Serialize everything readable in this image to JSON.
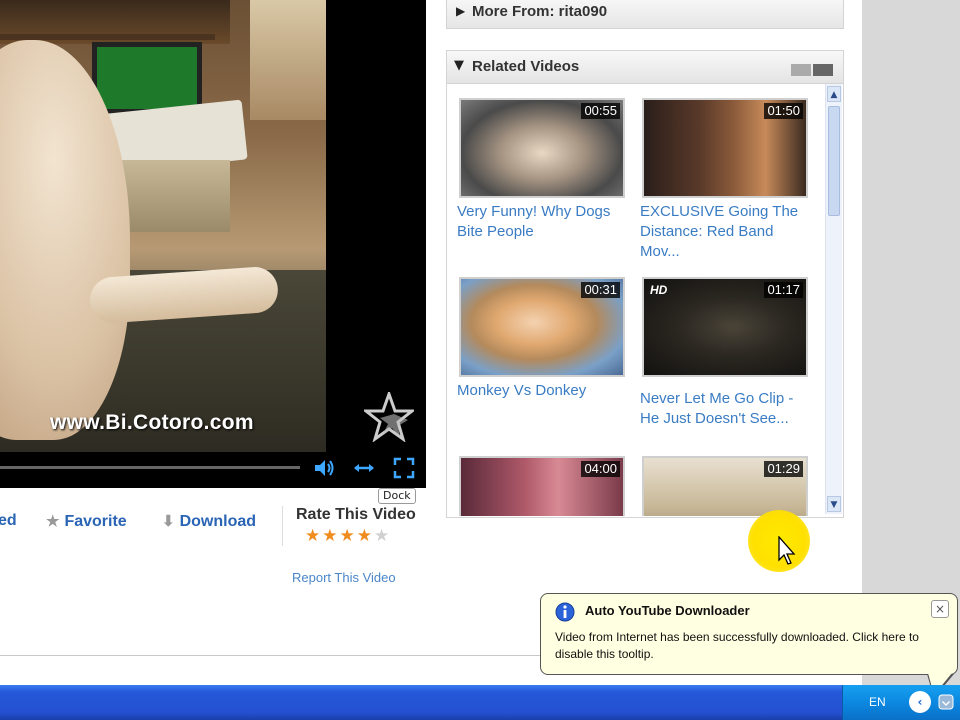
{
  "player": {
    "watermark": "www.Bi.Cotoro.com",
    "progress_fraction": 0.0,
    "dock_tooltip": "Dock"
  },
  "actions": {
    "items": [
      {
        "label": "ed",
        "icon": "embed-icon"
      },
      {
        "label": "Favorite",
        "icon": "star-icon"
      },
      {
        "label": "Download",
        "icon": "download-arrow-icon"
      }
    ],
    "rate_label": "Rate This Video",
    "rating": {
      "value": 4,
      "max": 5
    },
    "report": "Report This Video"
  },
  "more_from": {
    "label": "More From: rita090"
  },
  "related": {
    "label": "Related Videos",
    "videos": [
      {
        "title": "Very Funny! Why Dogs Bite People",
        "duration": "00:55",
        "hd": ""
      },
      {
        "title": "EXCLUSIVE Going The Distance: Red Band Mov...",
        "duration": "01:50",
        "hd": ""
      },
      {
        "title": "Monkey Vs Donkey",
        "duration": "00:31",
        "hd": ""
      },
      {
        "title": "Never Let Me Go Clip - He Just Doesn't See...",
        "duration": "01:17",
        "hd": "HD"
      },
      {
        "title": "",
        "duration": "04:00",
        "hd": ""
      },
      {
        "title": "",
        "duration": "01:29",
        "hd": ""
      }
    ]
  },
  "notification": {
    "title": "Auto YouTube Downloader",
    "message": "Video from Internet has been successfully downloaded. Click here to disable this tooltip.",
    "close": "×"
  },
  "taskbar": {
    "language": "EN",
    "tray_back": "‹"
  },
  "colors": {
    "link": "#3a7cc4",
    "accent": "#2a64b4",
    "rating": "#f08c1e",
    "taskbar": "#2458d8",
    "balloon": "#ffffe1"
  }
}
